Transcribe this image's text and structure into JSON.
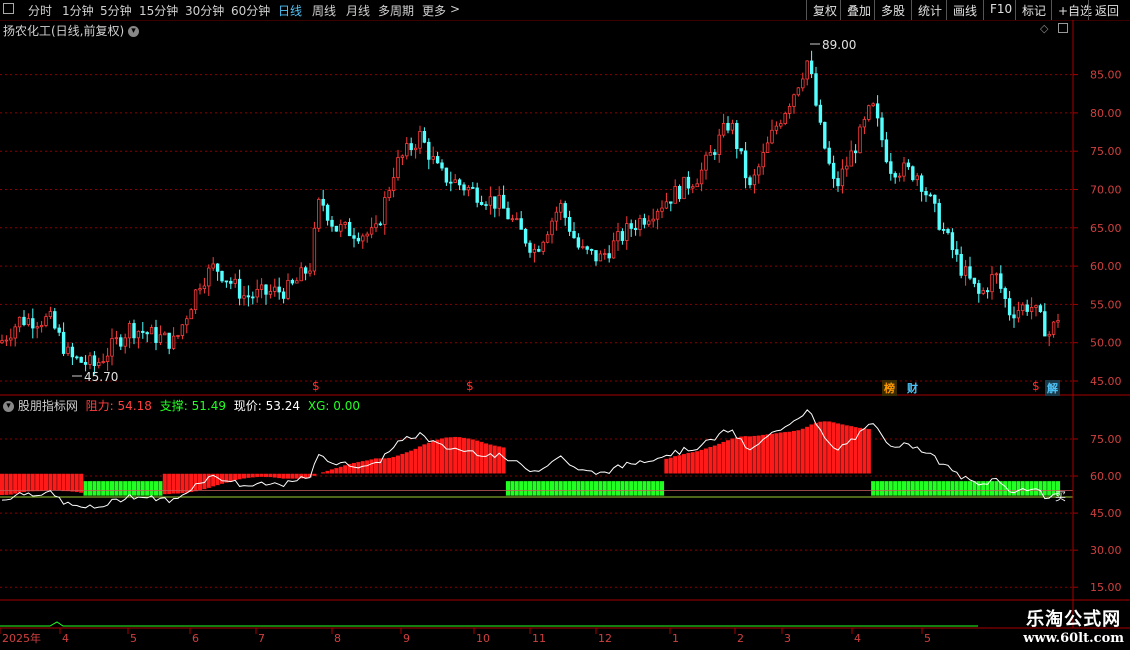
{
  "toolbar": {
    "periods": [
      "分时",
      "1分钟",
      "5分钟",
      "15分钟",
      "30分钟",
      "60分钟",
      "日线",
      "周线",
      "月线",
      "多周期",
      "更多"
    ],
    "active_period": "日线",
    "more_arrow": ">",
    "right_buttons": [
      "复权",
      "叠加",
      "多股",
      "统计",
      "画线",
      "F10",
      "标记",
      "+自选",
      "返回"
    ]
  },
  "main_panel": {
    "title": "扬农化工(日线,前复权)",
    "high_label": "89.00",
    "low_label": "45.70",
    "y_ticks": [
      "85.00",
      "80.00",
      "75.00",
      "70.00",
      "65.00",
      "60.00",
      "55.00",
      "50.00",
      "45.00"
    ],
    "markers": [
      "$",
      "$",
      "$"
    ],
    "badges": [
      {
        "text": "榜",
        "color": "#ff9900"
      },
      {
        "text": "财",
        "color": "#4fc3f7"
      },
      {
        "text": "解",
        "color": "#4fc3f7"
      }
    ]
  },
  "indicator_panel": {
    "name": "股朋指标网",
    "resist_label": "阻力:",
    "resist_value": "54.18",
    "support_label": "支撑:",
    "support_value": "51.49",
    "price_label": "现价:",
    "price_value": "53.24",
    "xg_label": "XG:",
    "xg_value": "0.00",
    "y_ticks": [
      "75.00",
      "60.00",
      "45.00",
      "30.00",
      "15.00"
    ],
    "buy_tag": "买"
  },
  "time_axis": {
    "labels": [
      "2025年",
      "4",
      "5",
      "6",
      "7",
      "8",
      "9",
      "10",
      "11",
      "12",
      "1",
      "2",
      "3",
      "4",
      "5"
    ]
  },
  "watermark": {
    "line1": "乐淘公式网",
    "line2": "www.60lt.com"
  },
  "colors": {
    "up": "#ff3c3c",
    "down": "#54ffff",
    "red_area": "#ff1a1a",
    "green_area": "#22ff22",
    "grid": "#8b0000",
    "active": "#4fc3f7"
  }
}
